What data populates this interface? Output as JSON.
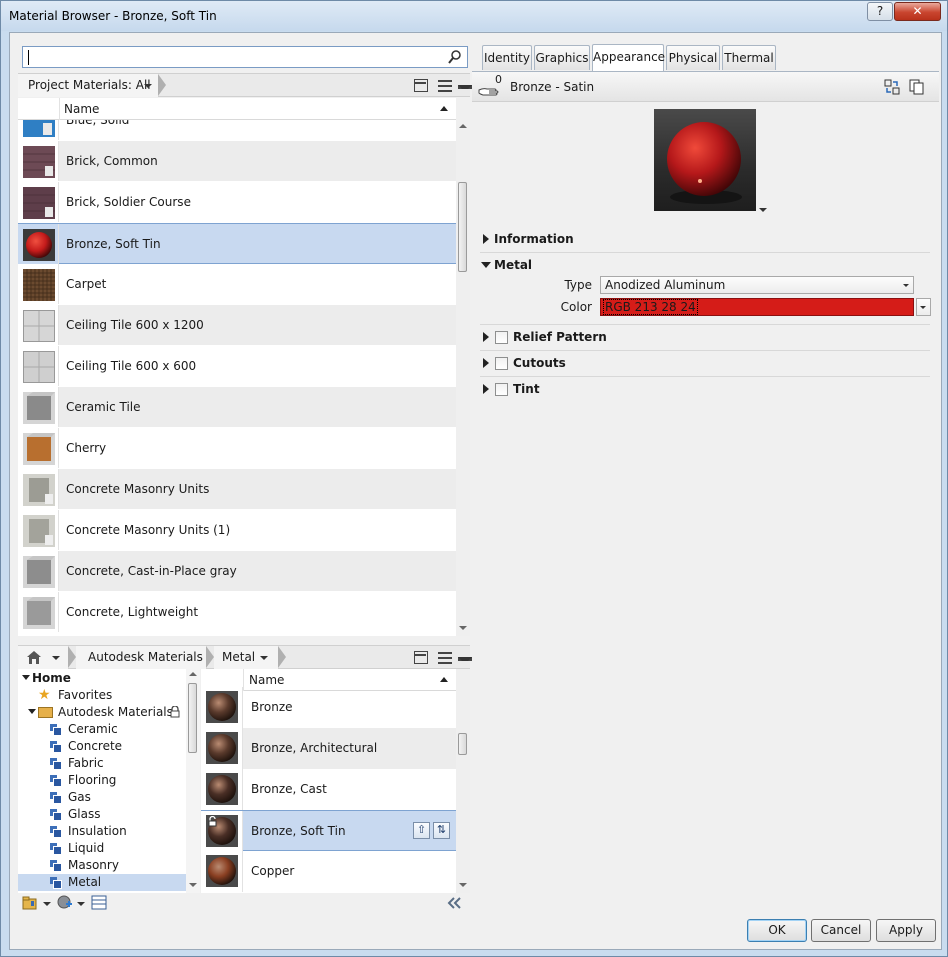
{
  "window": {
    "title": "Material Browser - Bronze, Soft Tin",
    "help_label": "?",
    "close_label": "✕"
  },
  "search": {
    "value": "",
    "placeholder": ""
  },
  "project": {
    "filter_label": "Project Materials: All",
    "column_name": "Name",
    "materials": [
      {
        "name": "Blue, Solid",
        "swatch": "#2f7fc4",
        "style": "flat"
      },
      {
        "name": "Brick, Common",
        "swatch": "#6d4a55",
        "style": "brick"
      },
      {
        "name": "Brick, Soldier Course",
        "swatch": "#5e3e4a",
        "style": "brick"
      },
      {
        "name": "Bronze, Soft Tin",
        "swatch": "#c41b1b",
        "style": "sphere",
        "selected": true
      },
      {
        "name": "Carpet",
        "swatch": "#6b4a2f",
        "style": "carpet"
      },
      {
        "name": "Ceiling Tile 600 x 1200",
        "swatch": "#d6d6d6",
        "style": "tile"
      },
      {
        "name": "Ceiling Tile 600 x 600",
        "swatch": "#cfcfcf",
        "style": "tile"
      },
      {
        "name": "Ceramic Tile",
        "swatch": "#8a8a8a",
        "style": "cube"
      },
      {
        "name": "Cherry",
        "swatch": "#b86f2f",
        "style": "cube"
      },
      {
        "name": "Concrete Masonry Units",
        "swatch": "#9c9c94",
        "style": "cmu"
      },
      {
        "name": "Concrete Masonry Units (1)",
        "swatch": "#a3a39b",
        "style": "cmu"
      },
      {
        "name": "Concrete, Cast-in-Place gray",
        "swatch": "#8d8d8d",
        "style": "cube"
      },
      {
        "name": "Concrete, Lightweight",
        "swatch": "#9a9a9a",
        "style": "cube"
      }
    ]
  },
  "library": {
    "crumbs": [
      "Autodesk Materials",
      "Metal"
    ],
    "tree": [
      {
        "label": "Home",
        "level": 0,
        "bold": true,
        "icon": "expanded-arrow"
      },
      {
        "label": "Favorites",
        "level": 1,
        "icon": "star-icon"
      },
      {
        "label": "Autodesk Materials",
        "level": 1,
        "icon": "folder-icon",
        "locked": true
      },
      {
        "label": "Ceramic",
        "level": 2,
        "icon": "category-icon"
      },
      {
        "label": "Concrete",
        "level": 2,
        "icon": "category-icon"
      },
      {
        "label": "Fabric",
        "level": 2,
        "icon": "category-icon"
      },
      {
        "label": "Flooring",
        "level": 2,
        "icon": "category-icon"
      },
      {
        "label": "Gas",
        "level": 2,
        "icon": "category-icon"
      },
      {
        "label": "Glass",
        "level": 2,
        "icon": "category-icon"
      },
      {
        "label": "Insulation",
        "level": 2,
        "icon": "category-icon"
      },
      {
        "label": "Liquid",
        "level": 2,
        "icon": "category-icon"
      },
      {
        "label": "Masonry",
        "level": 2,
        "icon": "category-icon"
      },
      {
        "label": "Metal",
        "level": 2,
        "icon": "category-icon",
        "selected": true
      }
    ],
    "column_name": "Name",
    "items": [
      {
        "name": "Bronze",
        "swatch": "#5a3a2c"
      },
      {
        "name": "Bronze, Architectural",
        "swatch": "#5a3a2c"
      },
      {
        "name": "Bronze, Cast",
        "swatch": "#4a2f26"
      },
      {
        "name": "Bronze, Soft Tin",
        "swatch": "#4a2f26",
        "selected": true
      },
      {
        "name": "Copper",
        "swatch": "#8a3f22"
      }
    ]
  },
  "editor": {
    "tabs": [
      "Identity",
      "Graphics",
      "Appearance",
      "Physical",
      "Thermal"
    ],
    "active_tab": "Appearance",
    "asset_count": "0",
    "asset_name": "Bronze - Satin",
    "sections": {
      "information": "Information",
      "metal": "Metal",
      "relief": "Relief Pattern",
      "cutouts": "Cutouts",
      "tint": "Tint"
    },
    "type_label": "Type",
    "type_value": "Anodized Aluminum",
    "color_label": "Color",
    "color_value": "RGB 213 28 24",
    "color_hex": "#d51c18"
  },
  "buttons": {
    "ok": "OK",
    "cancel": "Cancel",
    "apply": "Apply"
  }
}
